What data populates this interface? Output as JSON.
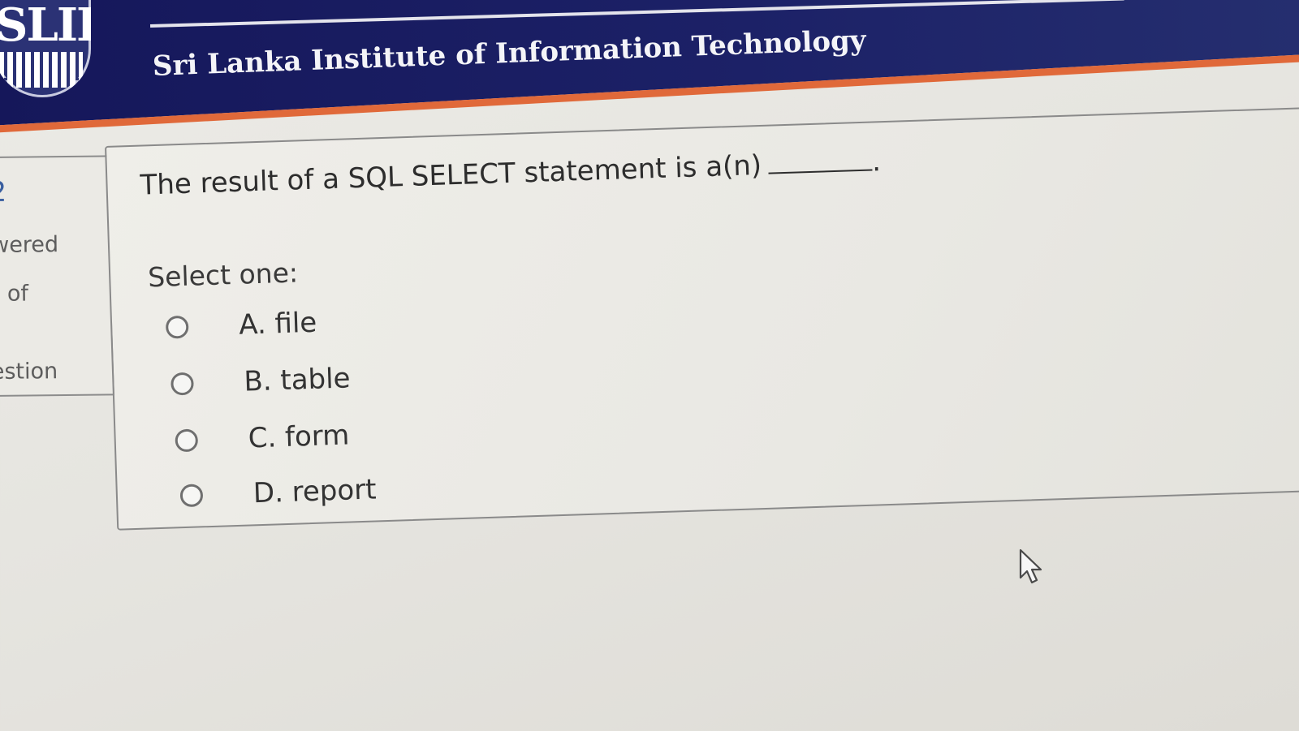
{
  "header": {
    "logo_text": "SLIIT",
    "institution_name": "Sri Lanka Institute of Information Technology"
  },
  "sidebar": {
    "question_number": "2",
    "status": "wered",
    "marks": "t of",
    "flag": "estion"
  },
  "question": {
    "prompt": "The result of a SQL SELECT statement is a(n)",
    "trailing": ".",
    "select_label": "Select one:",
    "options": [
      {
        "label": "A. file",
        "selected": false
      },
      {
        "label": "B. table",
        "selected": false
      },
      {
        "label": "C. form",
        "selected": false
      },
      {
        "label": "D. report",
        "selected": false
      }
    ]
  },
  "colors": {
    "header_navy": "#1c2167",
    "header_accent_orange": "#e0693a",
    "page_background": "#e8e7e2"
  },
  "icons": [
    "sliit-logo",
    "radio-unchecked-icon",
    "mouse-cursor-icon"
  ]
}
